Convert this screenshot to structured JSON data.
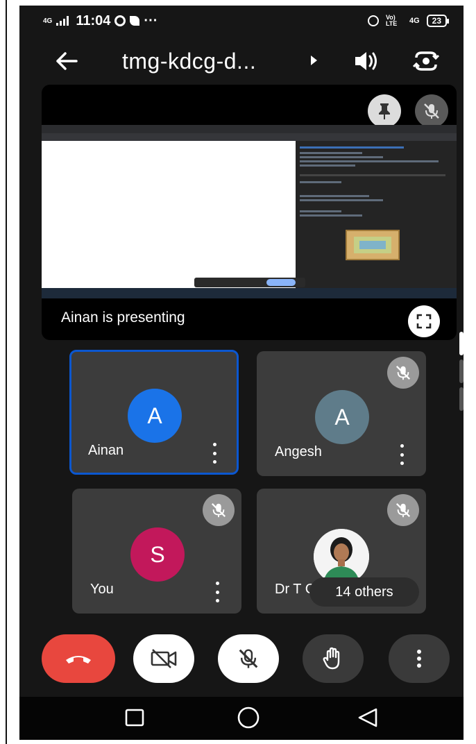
{
  "status_bar": {
    "network": "4G",
    "time": "11:04",
    "dots": "···",
    "lte": "Vo) LTE",
    "net2": "4G",
    "battery": "23"
  },
  "header": {
    "title": "tmg-kdcg-d..."
  },
  "presentation": {
    "label": "Ainan is presenting"
  },
  "tiles": [
    {
      "name": "Ainan",
      "initial": "A",
      "color": "#1a73e8"
    },
    {
      "name": "Angesh",
      "initial": "A",
      "color": "#5f7c8a"
    },
    {
      "name": "You",
      "initial": "S",
      "color": "#c2185b"
    },
    {
      "name": "Dr T C",
      "others": "14 others"
    }
  ]
}
